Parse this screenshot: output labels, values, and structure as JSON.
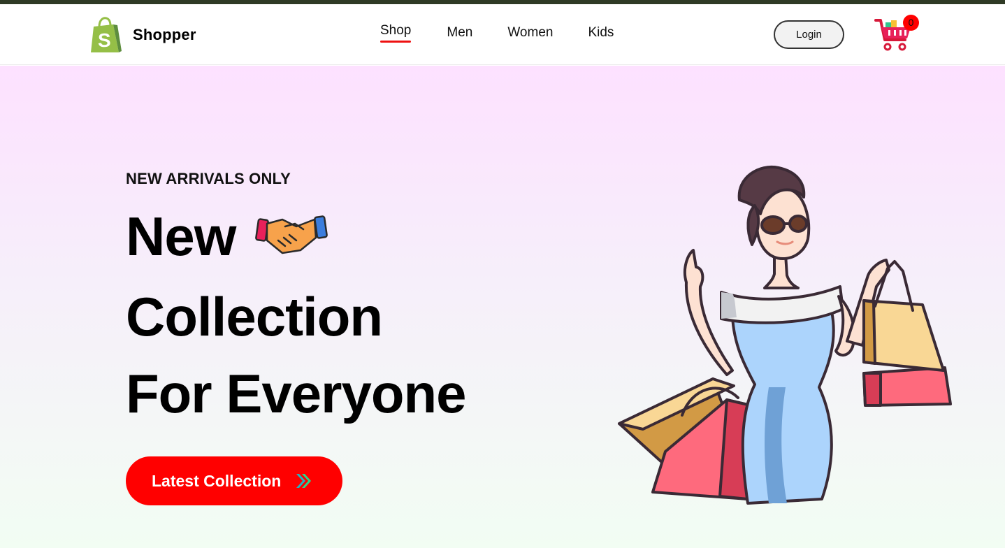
{
  "brand": {
    "name": "Shopper"
  },
  "nav": {
    "items": [
      {
        "label": "Shop",
        "active": true
      },
      {
        "label": "Men"
      },
      {
        "label": "Women"
      },
      {
        "label": "Kids"
      }
    ],
    "login_label": "Login",
    "cart_count": "0"
  },
  "hero": {
    "eyebrow": "NEW ARRIVALS ONLY",
    "line1": "New",
    "line2": "Collection",
    "line3": "For Everyone",
    "cta_label": "Latest Collection"
  },
  "colors": {
    "accent": "#ff0000",
    "topbar": "#2f3a25",
    "hero_top": "#fde1ff",
    "hero_bottom": "#f2fdf3"
  },
  "icons": {
    "logo": "shopify-bag-icon",
    "cart": "shopping-cart-icon",
    "hand": "handshake-icon",
    "cta_arrow": "double-arrow-icon"
  }
}
